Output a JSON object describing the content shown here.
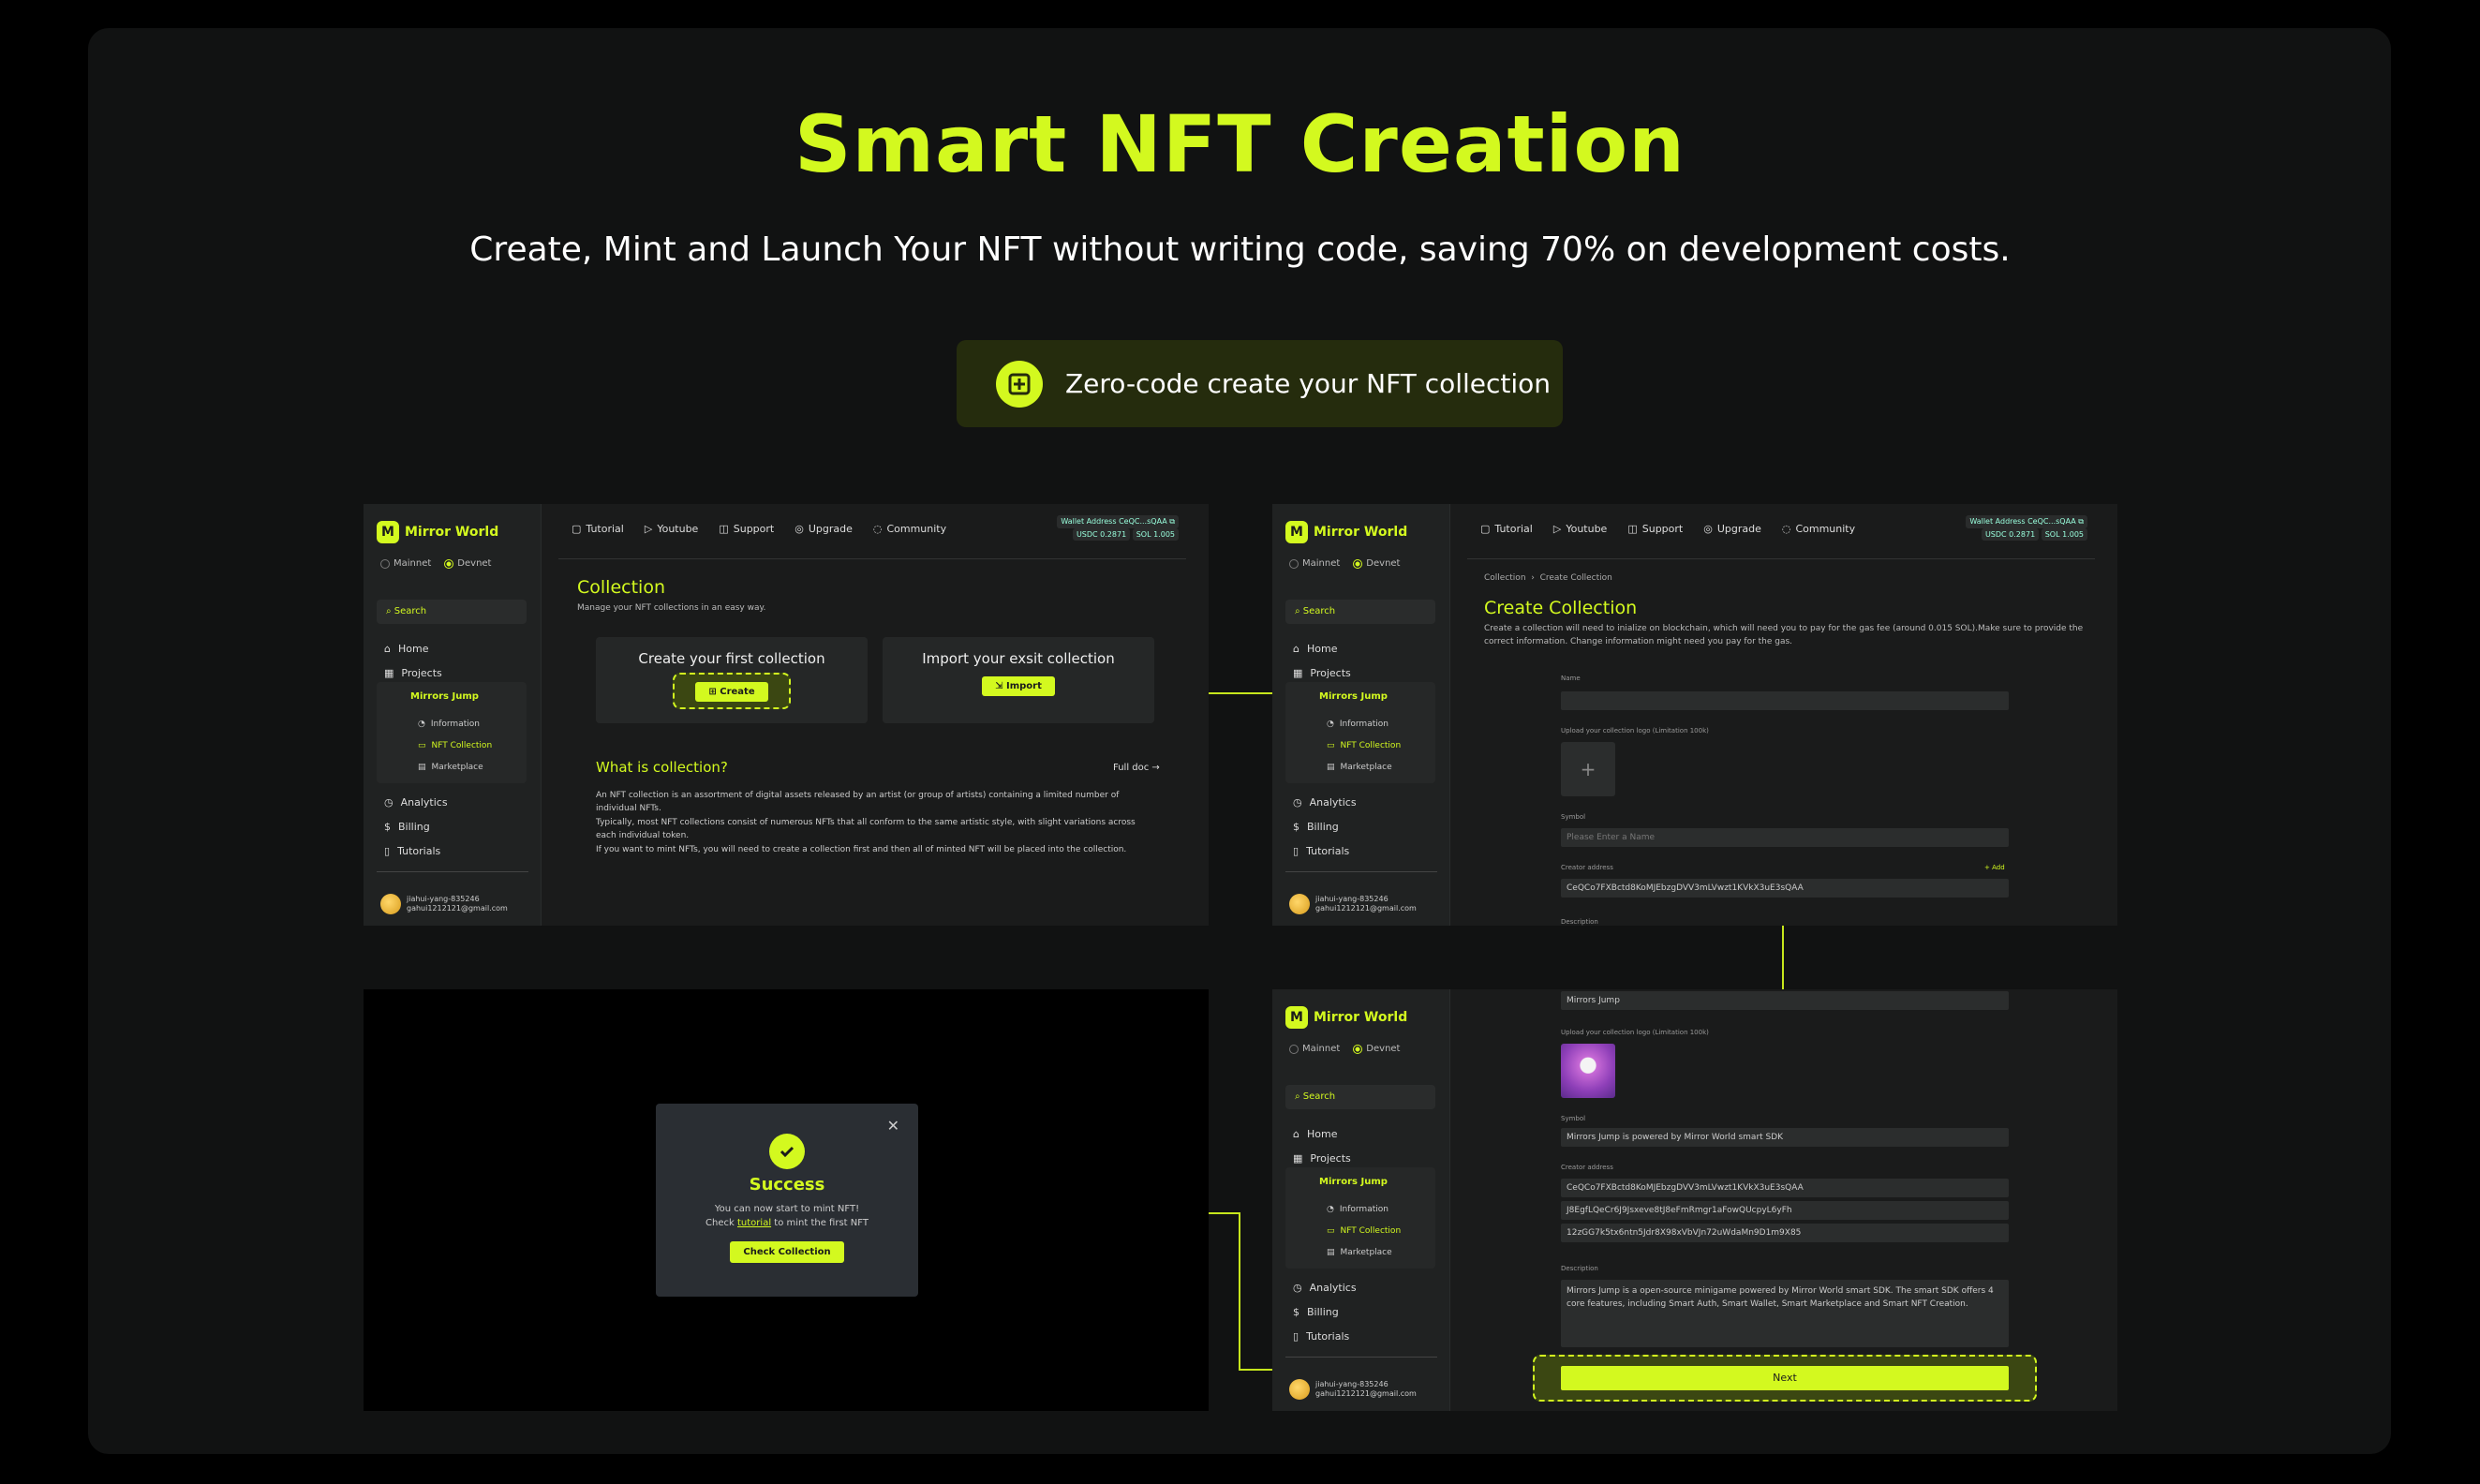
{
  "hero": {
    "title": "Smart NFT Creation",
    "subtitle": "Create, Mint and Launch Your NFT without writing code, saving 70% on development costs.",
    "cta": "Zero-code create your NFT collection"
  },
  "app": {
    "brand": "Mirror World",
    "networks": [
      "Mainnet",
      "Devnet"
    ],
    "search": "Search",
    "nav": [
      "Home",
      "Projects",
      "Analytics",
      "Billing",
      "Tutorials"
    ],
    "project": "Mirrors Jump",
    "subnav": [
      "Information",
      "NFT Collection",
      "Marketplace"
    ],
    "user_name": "jiahui-yang-835246",
    "user_email": "gahui1212121@gmail.com",
    "topnav": [
      "Tutorial",
      "Youtube",
      "Support",
      "Upgrade",
      "Community"
    ],
    "wallet_label": "Wallet Address",
    "wallet_addr": "CeQC...sQAA",
    "usdc": "USDC 0.2871",
    "sol": "SOL 1.005"
  },
  "collection": {
    "title": "Collection",
    "desc": "Manage your NFT collections in an easy way.",
    "card1": "Create your first collection",
    "create": "Create",
    "card2": "Import your exsit collection",
    "import": "Import",
    "what": "What is collection?",
    "full_doc": "Full doc",
    "p1": "An NFT collection is an assortment of digital assets released by an artist (or group of artists) containing a limited number of individual NFTs.",
    "p2": "Typically, most NFT collections consist of numerous NFTs that all conform to the same artistic style, with slight variations across each individual token.",
    "p3": "If you want to mint NFTs, you will need to create a collection first and then all of minted NFT will be placed into the collection."
  },
  "create": {
    "crumb1": "Collection",
    "crumb2": "Create Collection",
    "title": "Create Collection",
    "desc": "Create a collection will need to inialize on blockchain, which will need you to pay for the gas fee (around 0.015 SOL).Make sure to provide the correct information. Change information might need you pay for the gas.",
    "name_label": "Name",
    "logo_label": "Upload your collection logo",
    "logo_hint": "(Limitation 100k)",
    "symbol_label": "Symbol",
    "symbol_ph": "Please Enter a Name",
    "creator_label": "Creator address",
    "add": "+ Add",
    "creator_value": "CeQCo7FXBctd8KoMJEbzgDVV3mLVwzt1KVkX3uE3sQAA",
    "desc_label": "Description"
  },
  "filled": {
    "name": "Mirrors Jump",
    "symbol": "Mirrors Jump is powered by Mirror World smart SDK",
    "addr1": "CeQCo7FXBctd8KoMJEbzgDVV3mLVwzt1KVkX3uE3sQAA",
    "addr2": "J8EgfLQeCr6J9Jsxeve8tJ8eFmRmgr1aFowQUcpyL6yFh",
    "addr3": "12zGG7k5tx6ntn5Jdr8X98xVbVJn72uWdaMn9D1m9X85",
    "description": "Mirrors Jump is a open-source minigame powered by Mirror World smart SDK.  The smart SDK offers 4 core features, including Smart Auth, Smart Wallet, Smart Marketplace and Smart NFT Creation.",
    "next": "Next"
  },
  "success": {
    "title": "Success",
    "line1": "You can now start to mint NFT!",
    "check": "Check",
    "link": "tutorial",
    "line2": "to mint the first NFT",
    "button": "Check Collection"
  },
  "colors": {
    "accent": "#d3f91f",
    "bg": "#111212"
  }
}
